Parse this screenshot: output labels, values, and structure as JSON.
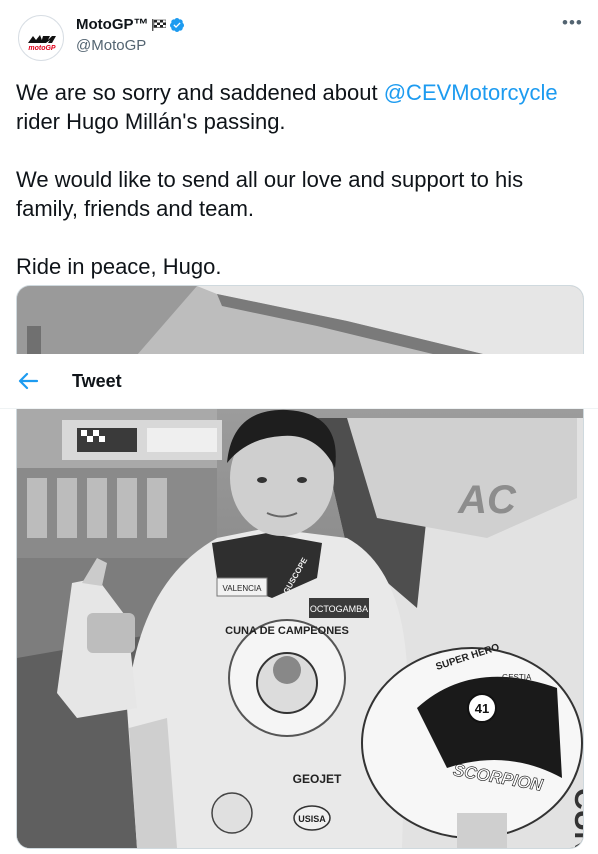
{
  "account": {
    "name": "MotoGP™",
    "handle": "@MotoGP",
    "avatar_logo": "motogp"
  },
  "menu_icon": "more-dots-icon",
  "tweet": {
    "line1_before": "We are so sorry and saddened about ",
    "mention": "@CEVMotorcycle",
    "line1_after": " rider Hugo Millán's passing.",
    "paragraph2": "We would like to send all our love and support to his family, friends and team.",
    "paragraph3": "Ride in peace, Hugo."
  },
  "topbar": {
    "title": "Tweet",
    "back_icon": "arrow-left-icon"
  },
  "photo": {
    "chest_brand": "CUNA DE CAMPEONES",
    "sponsor_valencia": "VALENCIA",
    "sponsor_octogamba": "OCTOGAMBA",
    "sponsor_geojet": "GEOJET",
    "sponsor_usisa": "USISA",
    "sponsor_guscope": "GUSCOPE",
    "helmet_brand": "SCORPION",
    "helmet_number": "41",
    "helmet_text": "SUPER HERO",
    "helmet_sponsor": "GESTIA",
    "sign_logo": "AC",
    "garage_sign": "CUNA"
  },
  "colors": {
    "accent": "#1d9bf0",
    "text": "#0f1419",
    "muted": "#536471",
    "border": "#cfd9de"
  }
}
